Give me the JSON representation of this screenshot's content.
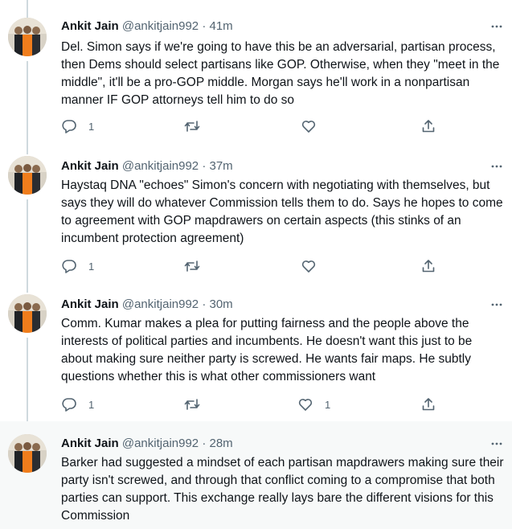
{
  "tweets": [
    {
      "name": "Ankit Jain",
      "handle": "@ankitjain992",
      "time": "· 41m",
      "text": "Del. Simon says if we're going to have this be an adversarial, partisan process, then Dems should select partisans like GOP. Otherwise, when they \"meet in the middle\", it'll be a pro-GOP middle. Morgan says he'll work in a nonpartisan manner IF GOP attorneys tell him to do so",
      "reply_count": "1",
      "retweet_count": "",
      "like_count": ""
    },
    {
      "name": "Ankit Jain",
      "handle": "@ankitjain992",
      "time": "· 37m",
      "text": "Haystaq DNA \"echoes\" Simon's concern with negotiating with themselves, but says they will do whatever Commission tells them to do. Says he hopes to come to agreement with GOP mapdrawers on certain aspects (this stinks of an incumbent protection agreement)",
      "reply_count": "1",
      "retweet_count": "",
      "like_count": ""
    },
    {
      "name": "Ankit Jain",
      "handle": "@ankitjain992",
      "time": "· 30m",
      "text": "Comm. Kumar makes a plea for putting fairness and the people above the interests of political parties and incumbents. He doesn't want this just to be about making sure neither party is screwed. He wants fair maps. He subtly questions whether this is what other commissioners want",
      "reply_count": "1",
      "retweet_count": "",
      "like_count": "1"
    },
    {
      "name": "Ankit Jain",
      "handle": "@ankitjain992",
      "time": "· 28m",
      "text": "Barker had suggested a mindset of each partisan mapdrawers making sure their party isn't screwed, and through that conflict coming to a compromise that both parties can support. This exchange really lays bare the different visions for this Commission",
      "reply_count": "",
      "retweet_count": "",
      "like_count": ""
    }
  ],
  "icons": {
    "reply": "reply-icon",
    "retweet": "retweet-icon",
    "like": "heart-icon",
    "share": "share-icon",
    "more": "more-icon"
  },
  "colors": {
    "text": "#0f1419",
    "secondary": "#536471",
    "thread_line": "#cfd9de",
    "hover_bg": "#f7f9f9",
    "shirt_orange": "#f07d1c"
  }
}
